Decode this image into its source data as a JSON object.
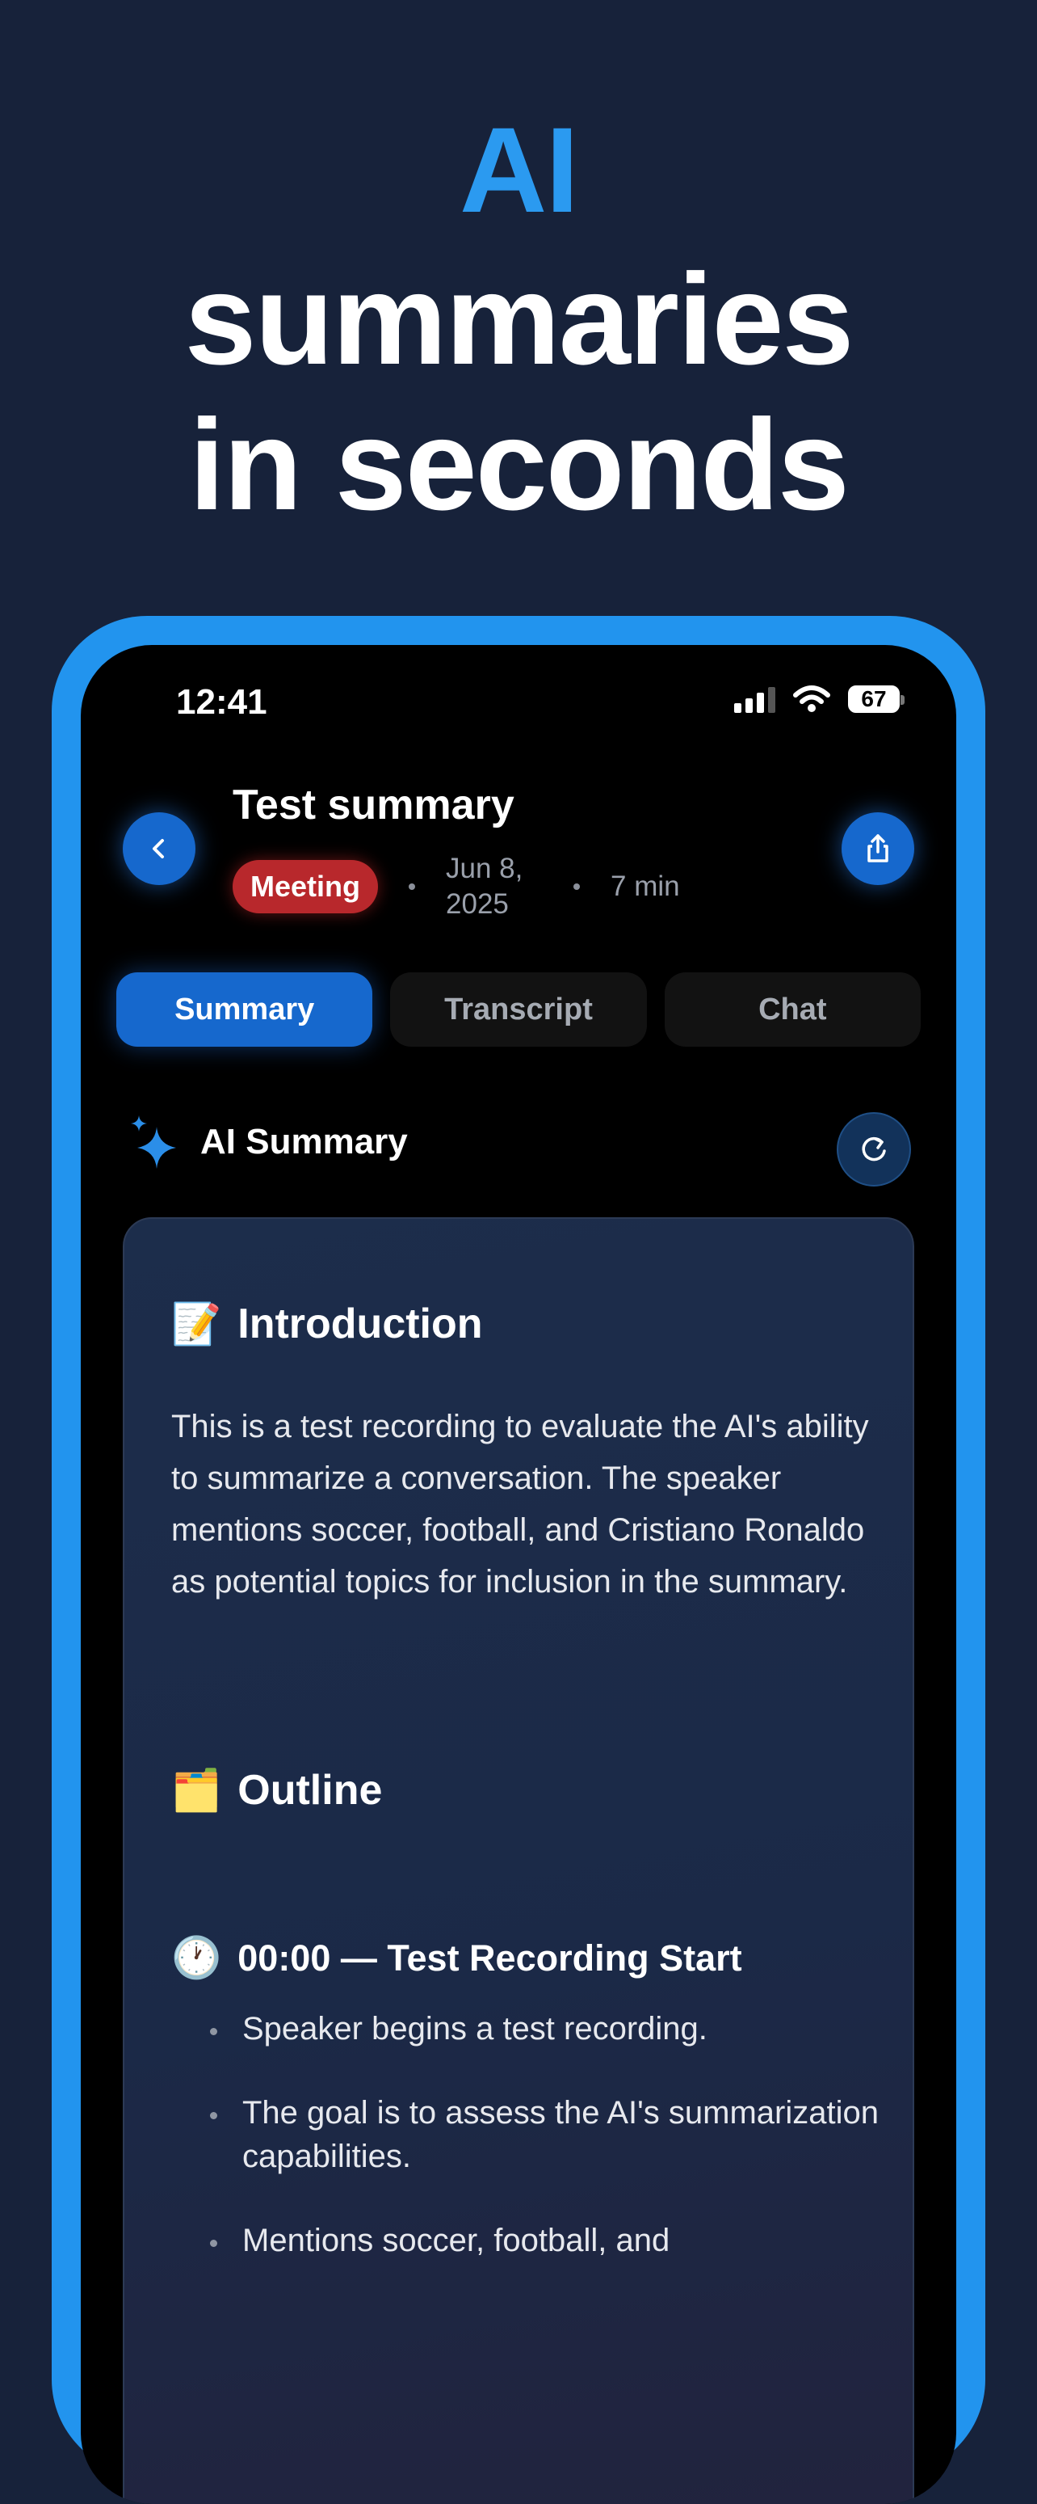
{
  "headline": {
    "line1": "AI",
    "line2": "summaries",
    "line3": "in seconds"
  },
  "status_bar": {
    "time": "12:41",
    "battery": "67"
  },
  "header": {
    "title": "Test summary",
    "badge": "Meeting",
    "date": "Jun 8, 2025",
    "duration": "7 min"
  },
  "tabs": [
    {
      "label": "Summary",
      "active": true
    },
    {
      "label": "Transcript",
      "active": false
    },
    {
      "label": "Chat",
      "active": false
    }
  ],
  "ai_summary": {
    "label": "AI Summary"
  },
  "content": {
    "intro": {
      "emoji": "📝",
      "title": "Introduction",
      "text": "This is a test recording to evaluate the AI's ability to summarize a conversation. The speaker mentions soccer, football, and Cristiano Ronaldo as potential topics for inclusion in the summary."
    },
    "outline": {
      "emoji": "🗂️",
      "title": "Outline"
    },
    "section": {
      "emoji": "🕐",
      "title": "00:00 — Test Recording Start",
      "bullets": [
        "Speaker begins a test recording.",
        "The goal is to assess the AI's summarization capabilities.",
        "Mentions soccer, football, and"
      ]
    }
  },
  "colors": {
    "accent": "#2294ee",
    "primary_button": "#1668cd",
    "badge_red": "#b8282c",
    "background": "#17223a"
  }
}
